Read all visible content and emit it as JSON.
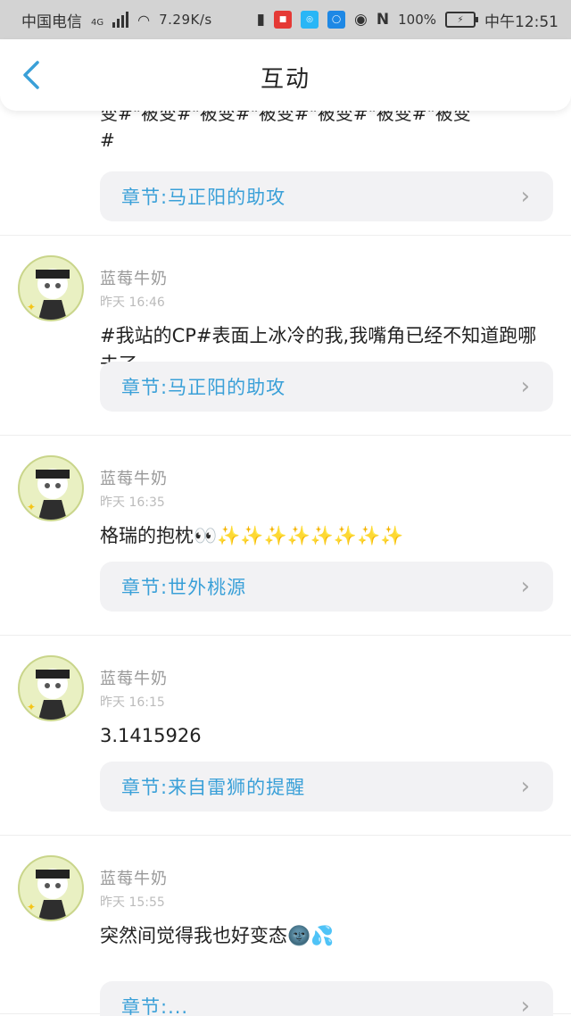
{
  "status_bar": {
    "carrier": "中国电信",
    "net": "4G",
    "speed": "7.29K/s",
    "battery_pct": "100%",
    "time": "中午12:51"
  },
  "header": {
    "title": "互动"
  },
  "partial_post": {
    "line1": "变#\"被变#\"被变#\"被变#\"被变#\"被变#\"被变",
    "line2": "#",
    "chapter": "章节:马正阳的助攻"
  },
  "posts": [
    {
      "name": "蓝莓牛奶",
      "time": "昨天 16:46",
      "content": "#我站的CP#表面上冰冷的我,我嘴角已经不知道跑哪去了",
      "chapter": "章节:马正阳的助攻"
    },
    {
      "name": "蓝莓牛奶",
      "time": "昨天 16:35",
      "content": "格瑞的抱枕👀✨✨✨✨✨✨✨✨",
      "chapter": "章节:世外桃源"
    },
    {
      "name": "蓝莓牛奶",
      "time": "昨天 16:15",
      "content": "3.1415926",
      "chapter": "章节:来自雷狮的提醒"
    },
    {
      "name": "蓝莓牛奶",
      "time": "昨天 15:55",
      "content": "突然间觉得我也好变态🌚💦",
      "chapter": "章节:..."
    }
  ],
  "colors": {
    "accent": "#3aa0d8",
    "status_bar": "#d3d3d3",
    "chapter_bg": "#f2f2f4"
  },
  "icons": {
    "back": "chevron-left-icon",
    "chapter_arrow": "chevron-right-icon"
  }
}
